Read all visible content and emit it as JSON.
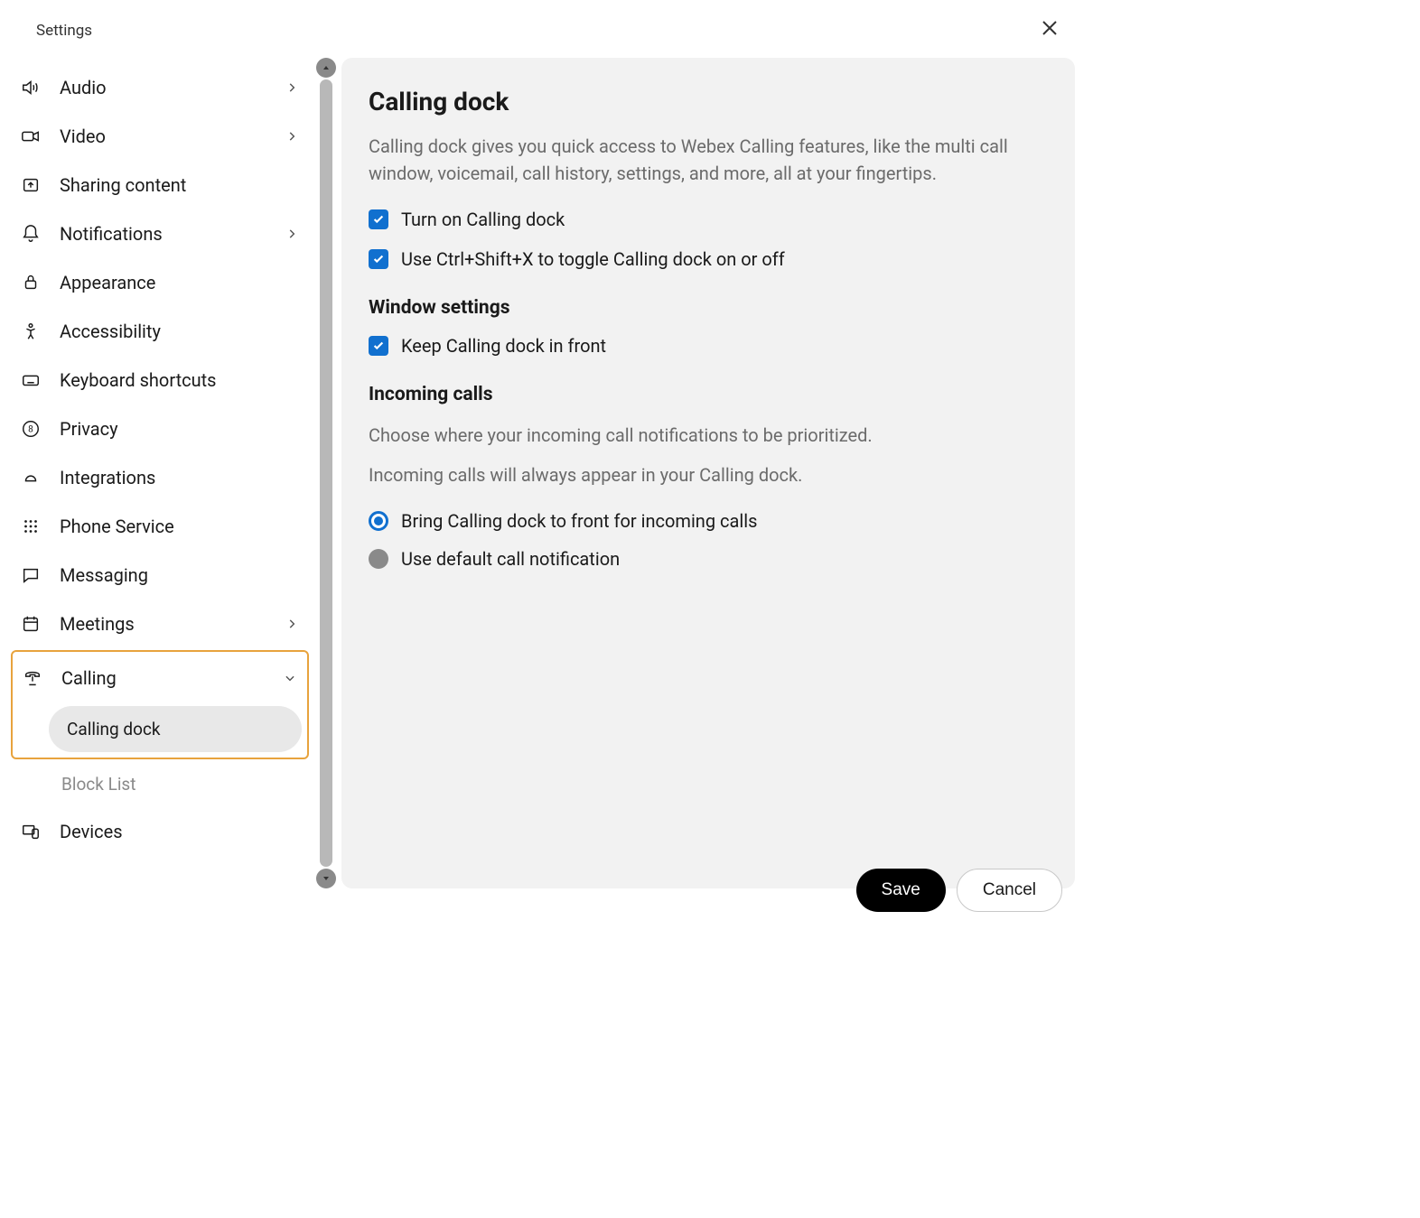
{
  "header": {
    "title": "Settings"
  },
  "sidebar": {
    "items": [
      {
        "label": "Audio",
        "icon": "audio",
        "has_chevron": true
      },
      {
        "label": "Video",
        "icon": "video",
        "has_chevron": true
      },
      {
        "label": "Sharing content",
        "icon": "sharing",
        "has_chevron": false
      },
      {
        "label": "Notifications",
        "icon": "notifications",
        "has_chevron": true
      },
      {
        "label": "Appearance",
        "icon": "appearance",
        "has_chevron": false
      },
      {
        "label": "Accessibility",
        "icon": "accessibility",
        "has_chevron": false
      },
      {
        "label": "Keyboard shortcuts",
        "icon": "keyboard",
        "has_chevron": false
      },
      {
        "label": "Privacy",
        "icon": "privacy",
        "has_chevron": false
      },
      {
        "label": "Integrations",
        "icon": "integrations",
        "has_chevron": false
      },
      {
        "label": "Phone Service",
        "icon": "phone",
        "has_chevron": false
      },
      {
        "label": "Messaging",
        "icon": "messaging",
        "has_chevron": false
      },
      {
        "label": "Meetings",
        "icon": "meetings",
        "has_chevron": true
      },
      {
        "label": "Calling",
        "icon": "calling",
        "expanded": true,
        "highlighted": true,
        "children": [
          {
            "label": "Calling dock",
            "selected": true
          },
          {
            "label": "Block List",
            "muted": true
          }
        ]
      },
      {
        "label": "Devices",
        "icon": "devices",
        "has_chevron": false
      }
    ]
  },
  "main": {
    "title": "Calling dock",
    "description": "Calling dock gives you quick access to Webex Calling features, like the multi call window, voicemail, call history, settings, and more, all at your fingertips.",
    "checkboxes": [
      {
        "label": "Turn on Calling dock",
        "checked": true
      },
      {
        "label": "Use Ctrl+Shift+X to toggle Calling dock on or off",
        "checked": true
      }
    ],
    "window_settings": {
      "heading": "Window settings",
      "checkboxes": [
        {
          "label": "Keep Calling dock in front",
          "checked": true
        }
      ]
    },
    "incoming_calls": {
      "heading": "Incoming calls",
      "subtext1": "Choose where your incoming call notifications to be prioritized.",
      "subtext2": "Incoming calls will always appear in your Calling dock.",
      "radios": [
        {
          "label": "Bring Calling dock to front for incoming calls",
          "selected": true
        },
        {
          "label": "Use default call notification",
          "selected": false
        }
      ]
    }
  },
  "footer": {
    "save": "Save",
    "cancel": "Cancel"
  }
}
